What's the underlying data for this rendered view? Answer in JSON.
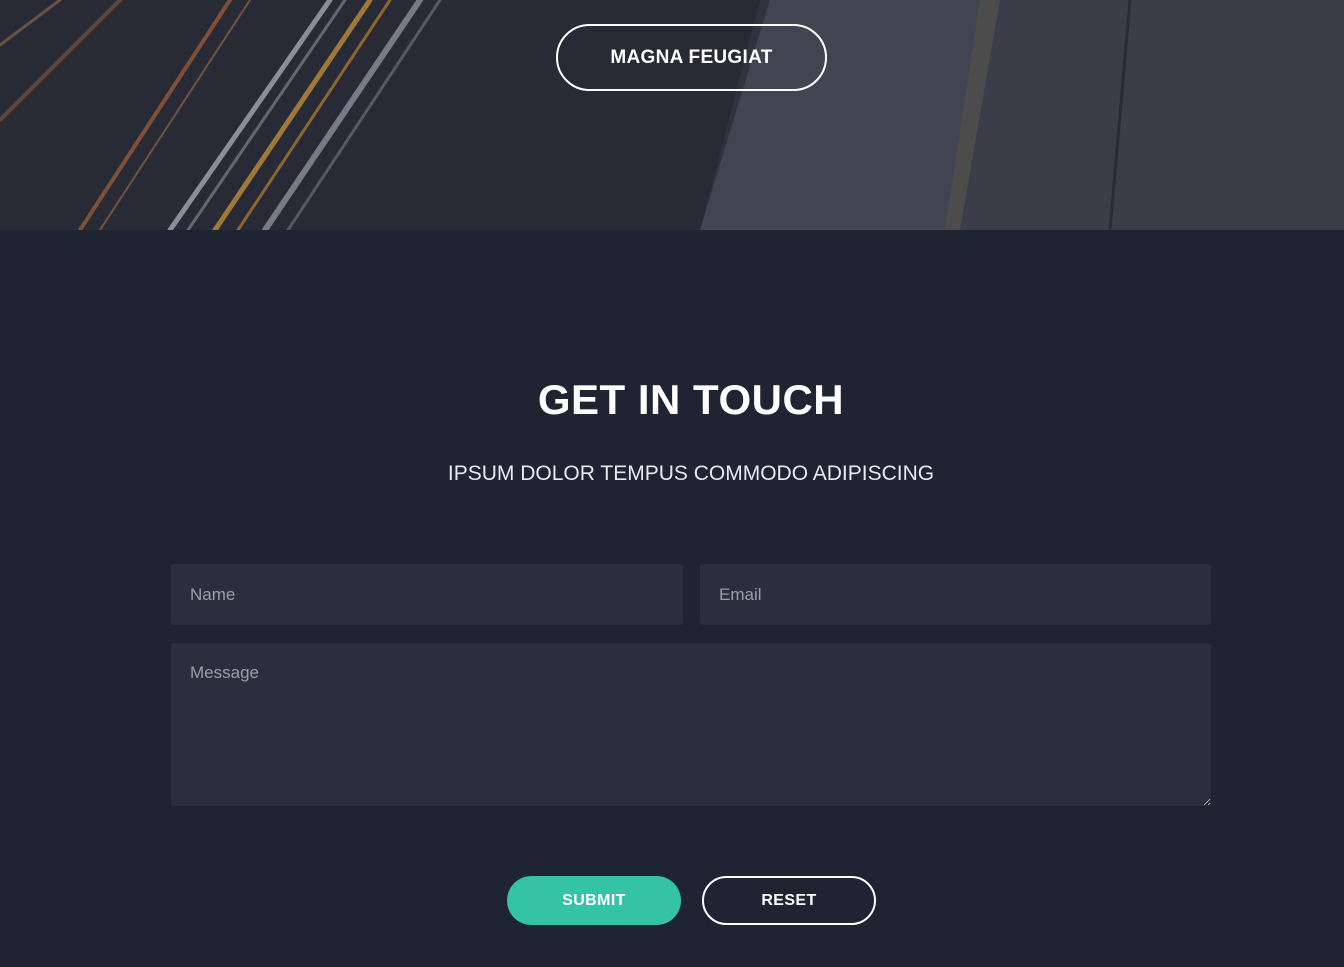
{
  "hero": {
    "button_label": "MAGNA FEUGIAT"
  },
  "contact": {
    "title": "GET IN TOUCH",
    "subtitle": "IPSUM DOLOR TEMPUS COMMODO ADIPISCING",
    "form": {
      "name_placeholder": "Name",
      "email_placeholder": "Email",
      "message_placeholder": "Message",
      "submit_label": "SUBMIT",
      "reset_label": "RESET"
    }
  },
  "colors": {
    "background": "#1f2433",
    "field_background": "#2a2f3d",
    "accent": "#35c3a5",
    "text": "#ffffff"
  }
}
